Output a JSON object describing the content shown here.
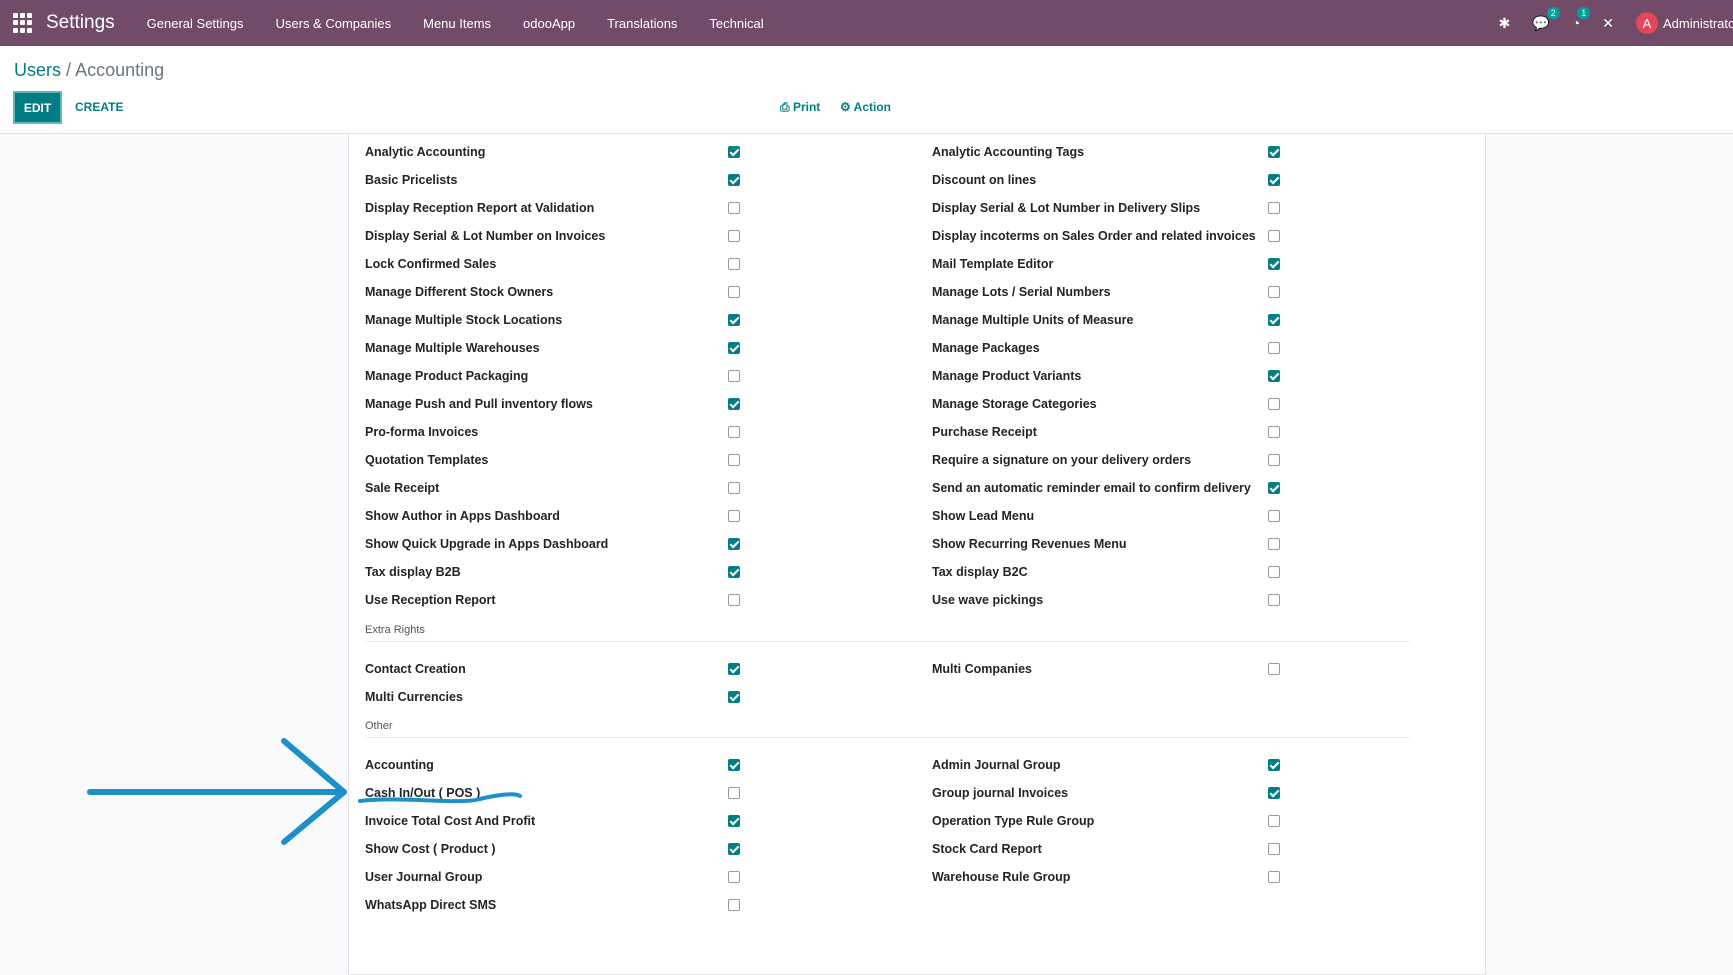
{
  "navbar": {
    "app_name": "Settings",
    "menu": [
      "General Settings",
      "Users & Companies",
      "Menu Items",
      "odooApp",
      "Translations",
      "Technical"
    ],
    "chat_badge": "2",
    "activity_badge": "1",
    "user_initial": "A",
    "user_name": "Administrator"
  },
  "breadcrumb": {
    "parent": "Users",
    "separator": "/",
    "current": "Accounting"
  },
  "buttons": {
    "edit": "EDIT",
    "create": "CREATE",
    "print": "Print",
    "action": "Action"
  },
  "colors": {
    "navbar": "#714b67",
    "accent": "#017e84",
    "annotation": "#1e90c8"
  },
  "technical_rows": [
    {
      "left": "Analytic Accounting",
      "left_checked": true,
      "right": "Analytic Accounting Tags",
      "right_checked": true
    },
    {
      "left": "Basic Pricelists",
      "left_checked": true,
      "right": "Discount on lines",
      "right_checked": true
    },
    {
      "left": "Display Reception Report at Validation",
      "left_checked": false,
      "right": "Display Serial & Lot Number in Delivery Slips",
      "right_checked": false
    },
    {
      "left": "Display Serial & Lot Number on Invoices",
      "left_checked": false,
      "right": "Display incoterms on Sales Order and related invoices",
      "right_checked": false
    },
    {
      "left": "Lock Confirmed Sales",
      "left_checked": false,
      "right": "Mail Template Editor",
      "right_checked": true
    },
    {
      "left": "Manage Different Stock Owners",
      "left_checked": false,
      "right": "Manage Lots / Serial Numbers",
      "right_checked": false
    },
    {
      "left": "Manage Multiple Stock Locations",
      "left_checked": true,
      "right": "Manage Multiple Units of Measure",
      "right_checked": true
    },
    {
      "left": "Manage Multiple Warehouses",
      "left_checked": true,
      "right": "Manage Packages",
      "right_checked": false
    },
    {
      "left": "Manage Product Packaging",
      "left_checked": false,
      "right": "Manage Product Variants",
      "right_checked": true
    },
    {
      "left": "Manage Push and Pull inventory flows",
      "left_checked": true,
      "right": "Manage Storage Categories",
      "right_checked": false
    },
    {
      "left": "Pro-forma Invoices",
      "left_checked": false,
      "right": "Purchase Receipt",
      "right_checked": false
    },
    {
      "left": "Quotation Templates",
      "left_checked": false,
      "right": "Require a signature on your delivery orders",
      "right_checked": false
    },
    {
      "left": "Sale Receipt",
      "left_checked": false,
      "right": "Send an automatic reminder email to confirm delivery",
      "right_checked": true
    },
    {
      "left": "Show Author in Apps Dashboard",
      "left_checked": false,
      "right": "Show Lead Menu",
      "right_checked": false
    },
    {
      "left": "Show Quick Upgrade in Apps Dashboard",
      "left_checked": true,
      "right": "Show Recurring Revenues Menu",
      "right_checked": false
    },
    {
      "left": "Tax display B2B",
      "left_checked": true,
      "right": "Tax display B2C",
      "right_checked": false
    },
    {
      "left": "Use Reception Report",
      "left_checked": false,
      "right": "Use wave pickings",
      "right_checked": false
    }
  ],
  "extra_rights": {
    "title": "Extra Rights",
    "rows": [
      {
        "left": "Contact Creation",
        "left_checked": true,
        "right": "Multi Companies",
        "right_checked": false
      },
      {
        "left": "Multi Currencies",
        "left_checked": true,
        "right": "",
        "right_checked": null
      }
    ]
  },
  "other": {
    "title": "Other",
    "rows": [
      {
        "left": "Accounting",
        "left_checked": true,
        "right": "Admin Journal Group",
        "right_checked": true
      },
      {
        "left": "Cash In/Out ( POS )",
        "left_checked": false,
        "right": "Group journal Invoices",
        "right_checked": true
      },
      {
        "left": "Invoice Total Cost And Profit",
        "left_checked": true,
        "right": "Operation Type Rule Group",
        "right_checked": false
      },
      {
        "left": "Show Cost ( Product )",
        "left_checked": true,
        "right": "Stock Card Report",
        "right_checked": false
      },
      {
        "left": "User Journal Group",
        "left_checked": false,
        "right": "Warehouse Rule Group",
        "right_checked": false
      },
      {
        "left": "WhatsApp Direct SMS",
        "left_checked": false,
        "right": "",
        "right_checked": null
      }
    ]
  }
}
